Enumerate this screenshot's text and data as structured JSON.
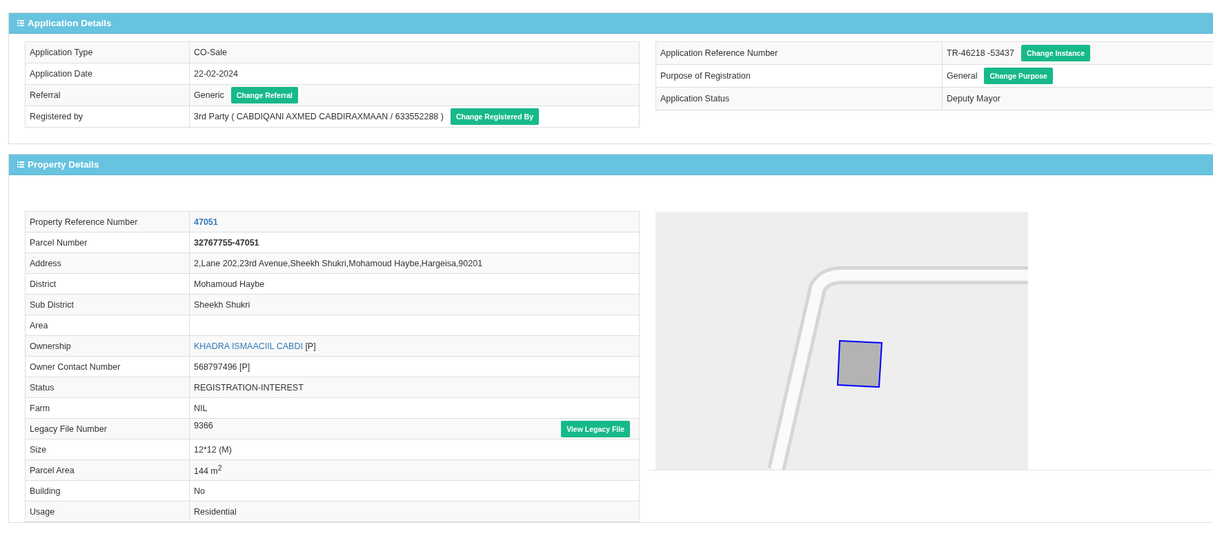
{
  "application_details": {
    "title": "Application Details",
    "left_table": [
      {
        "label": "Application Type",
        "value": "CO-Sale"
      },
      {
        "label": "Application Date",
        "value": "22-02-2024"
      },
      {
        "label": "Referral",
        "value": "Generic",
        "button": "Change Referral"
      },
      {
        "label": "Registered by",
        "value": "3rd Party ( CABDIQANI AXMED CABDIRAXMAAN / 633552288 )",
        "button": "Change Registered By"
      }
    ],
    "right_table": [
      {
        "label": "Application Reference Number",
        "value": "TR-46218 -53437",
        "button": "Change Instance"
      },
      {
        "label": "Purpose of Registration",
        "value": "General",
        "button": "Change Purpose"
      },
      {
        "label": "Application Status",
        "value": "Deputy Mayor"
      }
    ]
  },
  "property_details": {
    "title": "Property Details",
    "rows": [
      {
        "label": "Property Reference Number",
        "kind": "strong_link",
        "value": "47051"
      },
      {
        "label": "Parcel Number",
        "kind": "bold",
        "value": "32767755-47051"
      },
      {
        "label": "Address",
        "kind": "text",
        "value": "2,Lane 202,23rd Avenue,Sheekh Shukri,Mohamoud Haybe,Hargeisa,90201"
      },
      {
        "label": "District",
        "kind": "text",
        "value": "Mohamoud Haybe"
      },
      {
        "label": "Sub District",
        "kind": "text",
        "value": "Sheekh Shukri"
      },
      {
        "label": "Area",
        "kind": "text"
      },
      {
        "label": "Ownership",
        "kind": "link",
        "value": "KHADRA ISMAACIIL CABDI",
        "suffix": "[P]"
      },
      {
        "label": "Owner Contact Number",
        "kind": "text",
        "value": "568797496 [P]"
      },
      {
        "label": "Status",
        "kind": "text",
        "value": "REGISTRATION-INTEREST"
      },
      {
        "label": "Farm",
        "kind": "text",
        "value": "NIL"
      },
      {
        "label": "Legacy File Number",
        "kind": "text",
        "value": "9366",
        "button": "View Legacy File"
      },
      {
        "label": "Size",
        "kind": "text",
        "value": "12*12 (M)"
      },
      {
        "label": "Parcel Area",
        "kind": "text",
        "value": "144 m$^{2}$"
      },
      {
        "label": "Building",
        "kind": "text",
        "value": "No"
      },
      {
        "label": "Usage",
        "kind": "text",
        "value": "Residential"
      }
    ]
  }
}
